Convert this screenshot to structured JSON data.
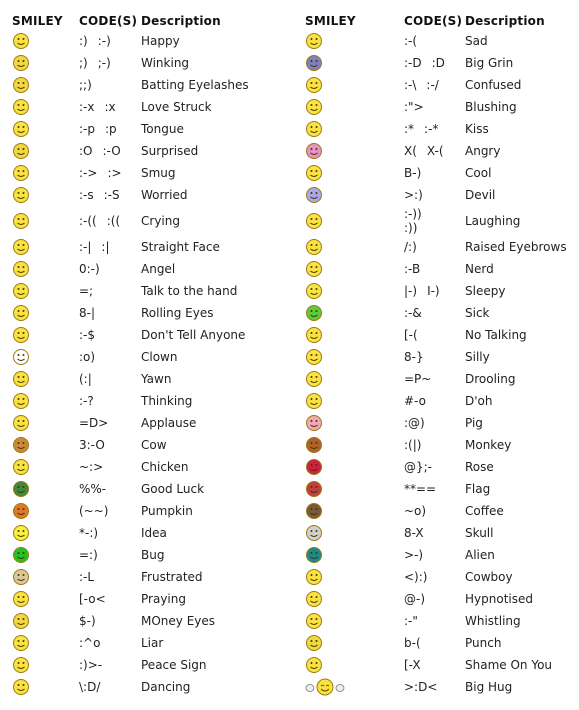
{
  "headers": {
    "smiley": "SMILEY",
    "codes": "CODE(S)",
    "description": "Description"
  },
  "left": [
    {
      "icon": "happy-icon",
      "face": "#f7e341",
      "codes": [
        ":)",
        ":-)"
      ],
      "description": "Happy"
    },
    {
      "icon": "winking-icon",
      "face": "#f0d840",
      "codes": [
        ";)",
        ";-)"
      ],
      "description": "Winking"
    },
    {
      "icon": "batting-eyelashes-icon",
      "face": "#f0d840",
      "codes": [
        ";;)"
      ],
      "description": "Batting Eyelashes"
    },
    {
      "icon": "love-struck-icon",
      "face": "#f7e341",
      "codes": [
        ":-x",
        ":x"
      ],
      "description": "Love Struck"
    },
    {
      "icon": "tongue-icon",
      "face": "#f7e341",
      "codes": [
        ":-p",
        ":p"
      ],
      "description": "Tongue"
    },
    {
      "icon": "surprised-icon",
      "face": "#f0d840",
      "codes": [
        ":O",
        ":-O"
      ],
      "description": "Surprised"
    },
    {
      "icon": "smug-icon",
      "face": "#f7e341",
      "codes": [
        ":->",
        ":>"
      ],
      "description": "Smug"
    },
    {
      "icon": "worried-icon",
      "face": "#f7e341",
      "codes": [
        ":-s",
        ":-S"
      ],
      "description": "Worried"
    },
    {
      "icon": "crying-icon",
      "face": "#f7e341",
      "codes": [
        ":-((",
        ":(("
      ],
      "description": "Crying",
      "tall": true
    },
    {
      "icon": "straight-face-icon",
      "face": "#f7e341",
      "codes": [
        ":-|",
        ":|"
      ],
      "description": "Straight Face"
    },
    {
      "icon": "angel-icon",
      "face": "#f7e341",
      "codes": [
        "0:-)"
      ],
      "description": "Angel"
    },
    {
      "icon": "talk-to-the-hand-icon",
      "face": "#f7e341",
      "codes": [
        "=;"
      ],
      "description": "Talk to the hand"
    },
    {
      "icon": "rolling-eyes-icon",
      "face": "#f7e341",
      "codes": [
        "8-|"
      ],
      "description": "Rolling Eyes"
    },
    {
      "icon": "dont-tell-anyone-icon",
      "face": "#f7e341",
      "codes": [
        ":-$"
      ],
      "description": "Don't Tell Anyone"
    },
    {
      "icon": "clown-icon",
      "face": "#ffffff",
      "codes": [
        ":o)"
      ],
      "description": "Clown"
    },
    {
      "icon": "yawn-icon",
      "face": "#f7e341",
      "codes": [
        "(:|"
      ],
      "description": "Yawn"
    },
    {
      "icon": "thinking-icon",
      "face": "#f7e341",
      "codes": [
        ":-?"
      ],
      "description": "Thinking"
    },
    {
      "icon": "applause-icon",
      "face": "#f7e341",
      "codes": [
        "=D>"
      ],
      "description": "Applause"
    },
    {
      "icon": "cow-icon",
      "face": "#c98a3a",
      "codes": [
        "3:-O"
      ],
      "description": "Cow"
    },
    {
      "icon": "chicken-icon",
      "face": "#f7e341",
      "codes": [
        "~:>"
      ],
      "description": "Chicken"
    },
    {
      "icon": "good-luck-icon",
      "face": "#3f8a3a",
      "codes": [
        "%%-"
      ],
      "description": "Good Luck"
    },
    {
      "icon": "pumpkin-icon",
      "face": "#e0782a",
      "codes": [
        "(~~)"
      ],
      "description": "Pumpkin"
    },
    {
      "icon": "idea-icon",
      "face": "#f7f040",
      "codes": [
        "*-:)"
      ],
      "description": "Idea"
    },
    {
      "icon": "bug-icon",
      "face": "#22c422",
      "codes": [
        "=:)"
      ],
      "description": "Bug"
    },
    {
      "icon": "frustrated-icon",
      "face": "#d8c8a0",
      "codes": [
        ":-L"
      ],
      "description": "Frustrated"
    },
    {
      "icon": "praying-icon",
      "face": "#f7e341",
      "codes": [
        "[-o<"
      ],
      "description": "Praying"
    },
    {
      "icon": "money-eyes-icon",
      "face": "#f0d840",
      "codes": [
        "$-)"
      ],
      "description": "MOney Eyes"
    },
    {
      "icon": "liar-icon",
      "face": "#f7e341",
      "codes": [
        ":^o"
      ],
      "description": "Liar"
    },
    {
      "icon": "peace-sign-icon",
      "face": "#f7e341",
      "codes": [
        ":)>-"
      ],
      "description": "Peace Sign"
    },
    {
      "icon": "dancing-icon",
      "face": "#f7e341",
      "codes": [
        "\\:D/"
      ],
      "description": "Dancing"
    }
  ],
  "right": [
    {
      "icon": "sad-icon",
      "face": "#f7e341",
      "codes": [
        ":-("
      ],
      "description": "Sad"
    },
    {
      "icon": "big-grin-icon",
      "face": "#8080c0",
      "codes": [
        ":-D",
        ":D"
      ],
      "description": "Big Grin"
    },
    {
      "icon": "confused-icon",
      "face": "#f7e341",
      "codes": [
        ":-\\",
        ":-/"
      ],
      "description": "Confused"
    },
    {
      "icon": "blushing-icon",
      "face": "#f7e341",
      "codes": [
        ":\">"
      ],
      "description": "Blushing"
    },
    {
      "icon": "kiss-icon",
      "face": "#f7e341",
      "codes": [
        ":*",
        ":-*"
      ],
      "description": "Kiss"
    },
    {
      "icon": "angry-icon",
      "face": "#e890c8",
      "codes": [
        "X(",
        "X-("
      ],
      "description": "Angry"
    },
    {
      "icon": "cool-icon",
      "face": "#f7e341",
      "codes": [
        "B-)"
      ],
      "description": "Cool"
    },
    {
      "icon": "devil-icon",
      "face": "#a8a8e8",
      "codes": [
        ">:)"
      ],
      "description": "Devil"
    },
    {
      "icon": "laughing-icon",
      "face": "#f7e341",
      "codes": [
        ":-))",
        ":))"
      ],
      "description": "Laughing",
      "tall": true,
      "stacked": true
    },
    {
      "icon": "raised-eyebrows-icon",
      "face": "#f7e341",
      "codes": [
        "/:)"
      ],
      "description": "Raised Eyebrows"
    },
    {
      "icon": "nerd-icon",
      "face": "#f7e341",
      "codes": [
        ":-B"
      ],
      "description": "Nerd"
    },
    {
      "icon": "sleepy-icon",
      "face": "#f7e341",
      "codes": [
        "|-)",
        "I-)"
      ],
      "description": "Sleepy"
    },
    {
      "icon": "sick-icon",
      "face": "#5ccc3a",
      "codes": [
        ":-&"
      ],
      "description": "Sick"
    },
    {
      "icon": "no-talking-icon",
      "face": "#f7e341",
      "codes": [
        "[-("
      ],
      "description": "No Talking"
    },
    {
      "icon": "silly-icon",
      "face": "#f7e341",
      "codes": [
        "8-}"
      ],
      "description": "Silly"
    },
    {
      "icon": "drooling-icon",
      "face": "#f7e341",
      "codes": [
        "=P~"
      ],
      "description": "Drooling"
    },
    {
      "icon": "doh-icon",
      "face": "#f7e341",
      "codes": [
        "#-o"
      ],
      "description": "D'oh"
    },
    {
      "icon": "pig-icon",
      "face": "#f0a8b8",
      "codes": [
        ":@)"
      ],
      "description": "Pig"
    },
    {
      "icon": "monkey-icon",
      "face": "#b0602a",
      "codes": [
        ":(|)"
      ],
      "description": "Monkey"
    },
    {
      "icon": "rose-icon",
      "face": "#d02040",
      "codes": [
        "@};-"
      ],
      "description": "Rose"
    },
    {
      "icon": "flag-icon",
      "face": "#c04040",
      "codes": [
        "**=="
      ],
      "description": "Flag"
    },
    {
      "icon": "coffee-icon",
      "face": "#7a5a3a",
      "codes": [
        "~o)"
      ],
      "description": "Coffee"
    },
    {
      "icon": "skull-icon",
      "face": "#d0d0d0",
      "codes": [
        "8-X"
      ],
      "description": "Skull"
    },
    {
      "icon": "alien-icon",
      "face": "#1a8a8a",
      "codes": [
        ">-)"
      ],
      "description": "Alien"
    },
    {
      "icon": "cowboy-icon",
      "face": "#f7e341",
      "codes": [
        "<):)"
      ],
      "description": "Cowboy"
    },
    {
      "icon": "hypnotised-icon",
      "face": "#f7e341",
      "codes": [
        "@-)"
      ],
      "description": "Hypnotised"
    },
    {
      "icon": "whistling-icon",
      "face": "#f7e341",
      "codes": [
        ":-\""
      ],
      "description": "Whistling"
    },
    {
      "icon": "punch-icon",
      "face": "#f0d840",
      "codes": [
        "b-("
      ],
      "description": "Punch"
    },
    {
      "icon": "shame-on-you-icon",
      "face": "#f7e341",
      "codes": [
        "[-X"
      ],
      "description": "Shame On You"
    },
    {
      "icon": "big-hug-icon",
      "face": "#f7e341",
      "codes": [
        ">:D<"
      ],
      "description": "Big Hug",
      "wide": true
    }
  ]
}
